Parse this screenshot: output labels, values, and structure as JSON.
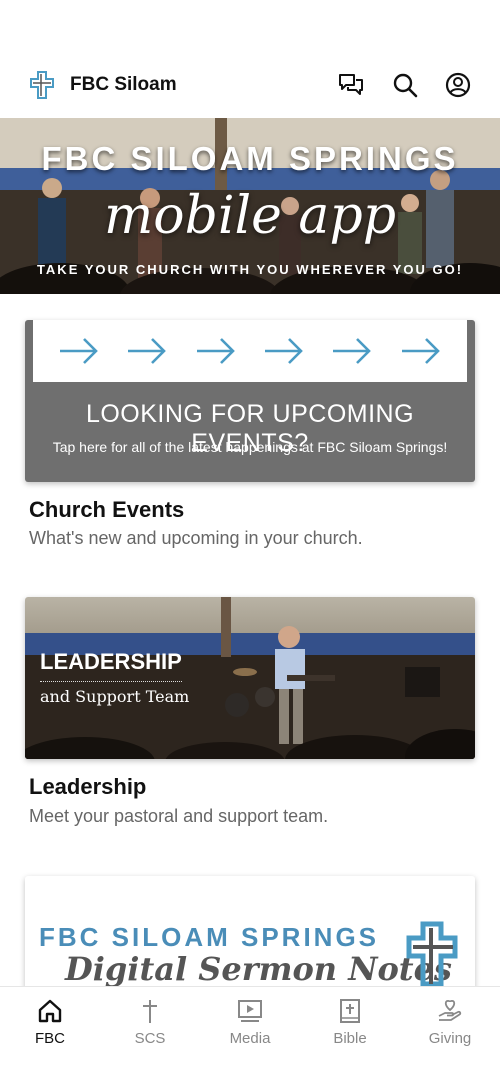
{
  "header": {
    "app_title": "FBC Siloam"
  },
  "hero": {
    "title": "FBC SILOAM SPRINGS",
    "script": "mobile app",
    "tagline": "TAKE YOUR CHURCH WITH YOU WHEREVER YOU GO!"
  },
  "items": [
    {
      "banner_headline": "LOOKING FOR UPCOMING EVENTS?",
      "banner_sub": "Tap here for all of the latest happenings at FBC Siloam Springs!",
      "title": "Church Events",
      "subtitle": "What's new and upcoming in your church."
    },
    {
      "banner_title": "LEADERSHIP",
      "banner_sub": "and Support Team",
      "title": "Leadership",
      "subtitle": "Meet your pastoral and support team."
    },
    {
      "banner_title": "FBC SILOAM SPRINGS",
      "banner_script": "Digital Sermon Notes"
    }
  ],
  "nav": [
    {
      "label": "FBC",
      "icon": "home-icon",
      "active": true
    },
    {
      "label": "SCS",
      "icon": "cross-icon",
      "active": false
    },
    {
      "label": "Media",
      "icon": "media-icon",
      "active": false
    },
    {
      "label": "Bible",
      "icon": "bible-icon",
      "active": false
    },
    {
      "label": "Giving",
      "icon": "giving-icon",
      "active": false
    }
  ],
  "colors": {
    "accent": "#4a9bc4",
    "banner_gray": "#6f6f6f",
    "text_secondary": "#666666"
  }
}
